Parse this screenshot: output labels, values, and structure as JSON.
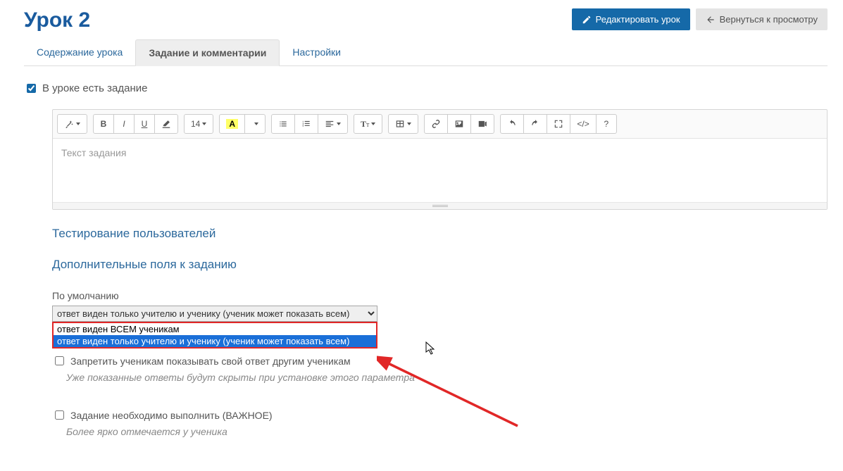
{
  "header": {
    "title": "Урок 2",
    "edit_button": "Редактировать урок",
    "back_button": "Вернуться к просмотру"
  },
  "tabs": {
    "content": "Содержание урока",
    "task": "Задание и комментарии",
    "settings": "Настройки"
  },
  "task_present": {
    "label": "В уроке есть задание",
    "checked": true
  },
  "editor": {
    "placeholder": "Текст задания",
    "font_size_label": "14"
  },
  "sections": {
    "testing": "Тестирование пользователей",
    "additional": "Дополнительные поля к заданию"
  },
  "default_visibility": {
    "label": "По умолчанию",
    "selected": "ответ виден только учителю и ученику (ученик может показать всем)",
    "options": [
      "ответ виден ВСЕМ ученикам",
      "ответ виден только учителю и ученику (ученик может показать всем)"
    ]
  },
  "forbid_show": {
    "label": "Запретить ученикам показывать свой ответ другим ученикам",
    "hint": "Уже показанные ответы будут скрыты при установке этого параметра",
    "checked": false
  },
  "mandatory": {
    "label": "Задание необходимо выполнить (ВАЖНОЕ)",
    "hint": "Более ярко отмечается у ученика",
    "checked": false
  },
  "toolbar": {
    "style_magic": "style",
    "bold": "B",
    "italic": "I",
    "underline": "U",
    "erase": "erase",
    "color": "A",
    "ul": "ul",
    "ol": "ol",
    "align": "align",
    "heading": "T",
    "table": "table",
    "link": "link",
    "image": "image",
    "video": "video",
    "undo": "undo",
    "redo": "redo",
    "fullscreen": "fullscreen",
    "code": "</>",
    "help": "?"
  }
}
